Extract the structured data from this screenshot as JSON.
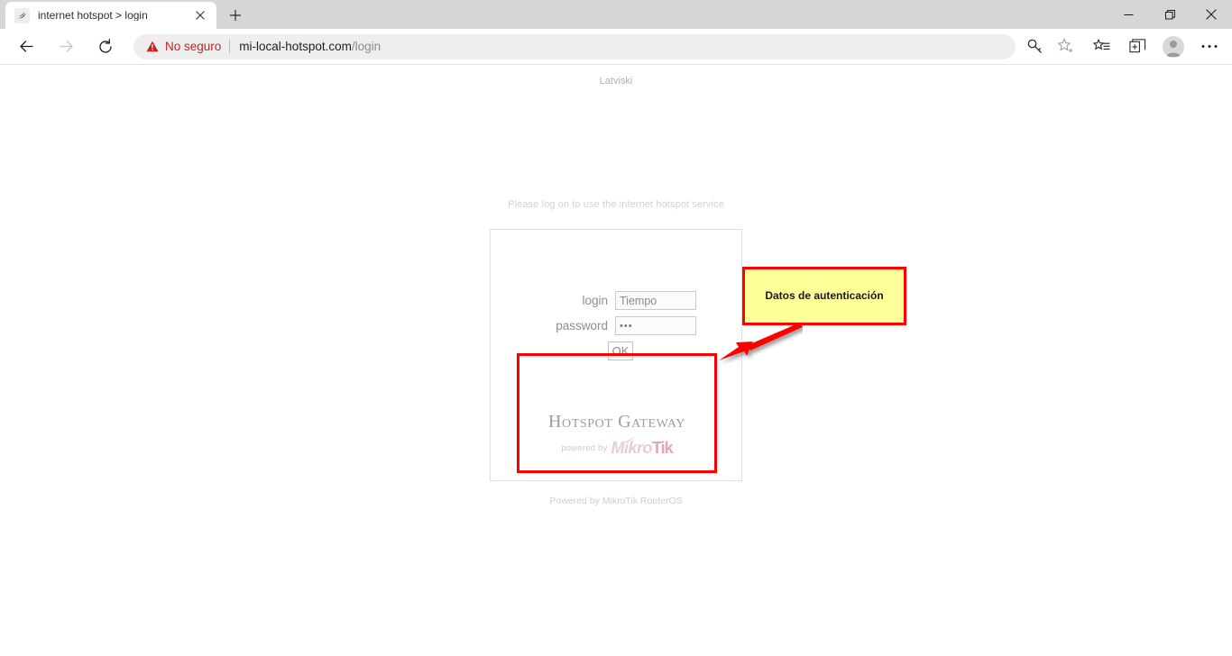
{
  "browser": {
    "tab": {
      "title": "internet hotspot > login",
      "favicon_icon": "mikrotik-swoosh-icon",
      "close_icon": "close-icon"
    },
    "new_tab_icon": "plus-icon",
    "window_controls": {
      "minimize_icon": "minimize-icon",
      "restore_icon": "restore-icon",
      "close_icon": "close-icon"
    },
    "nav": {
      "back_icon": "back-arrow-icon",
      "forward_icon": "forward-arrow-icon",
      "reload_icon": "reload-icon"
    },
    "address": {
      "warning_icon": "warning-triangle-icon",
      "security_label": "No seguro",
      "url_domain": "mi-local-hotspot.com",
      "url_path": "/login"
    },
    "actions": {
      "password_key_icon": "key-icon",
      "add_favorite_icon": "star-plus-icon",
      "favorites_icon": "favorites-list-icon",
      "collections_icon": "collections-icon",
      "profile_icon": "profile-avatar-icon",
      "settings_icon": "ellipsis-icon"
    }
  },
  "page": {
    "language_link": "Latviski",
    "prompt": "Please log on to use the internet hotspot service",
    "form": {
      "login_label": "login",
      "login_value": "Tiempo",
      "login_placeholder": "",
      "password_label": "password",
      "password_masked": "•••",
      "submit_label": "OK"
    },
    "brand": {
      "title": "Hotspot Gateway",
      "powered_by": "powered by",
      "logo_part1": "Mikro",
      "logo_part2": "Tik"
    },
    "footer": "Powered by MikroTik RouterOS"
  },
  "annotations": {
    "callout_text": "Datos de autenticación",
    "callout_bg": "#ffff99",
    "callout_border": "#ff0000",
    "highlight_border": "#ff0000",
    "arrow_color": "#ff0000"
  }
}
